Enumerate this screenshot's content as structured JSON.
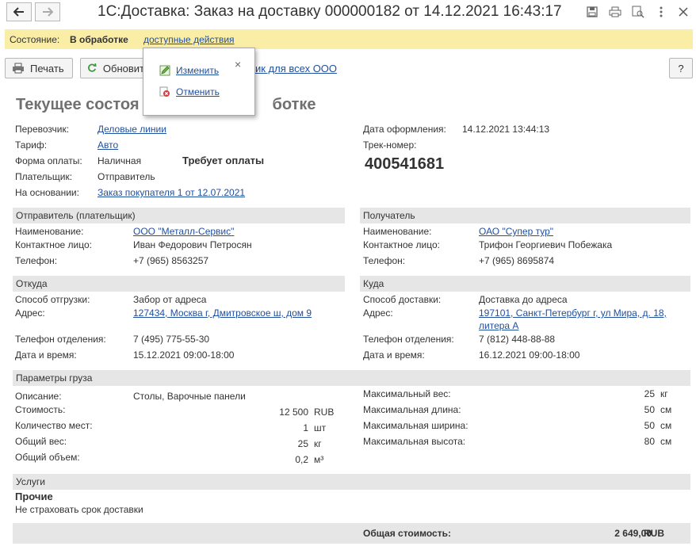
{
  "window": {
    "title": "1С:Доставка: Заказ на доставку 000000182 от 14.12.2021 16:43:17"
  },
  "statebar": {
    "label": "Состояние:",
    "value": "В обработке",
    "actions_link": "доступные действия"
  },
  "toolbar": {
    "print": "Печать",
    "refresh": "Обновит",
    "partial_link": "ик для всех ООО",
    "help": "?"
  },
  "popup": {
    "items": [
      {
        "label": "Изменить",
        "icon": "pencil-icon"
      },
      {
        "label": "Отменить",
        "icon": "cancel-icon"
      }
    ],
    "close": "×"
  },
  "heading": "Текущее состояние: в обработке",
  "heading_visible_left": "Текущее состоя",
  "heading_visible_right": "ботке",
  "general": {
    "carrier_label": "Перевозчик:",
    "carrier": "Деловые линии",
    "tariff_label": "Тариф:",
    "tariff": "Авто",
    "payment_label": "Форма оплаты:",
    "payment": "Наличная",
    "payment_status": "Требует оплаты",
    "payer_label": "Плательщик:",
    "payer": "Отправитель",
    "basis_label": "На основании:",
    "basis": "Заказ покупателя 1 от 12.07.2021",
    "date_label": "Дата оформления:",
    "date": "14.12.2021 13:44:13",
    "track_label": "Трек-номер:",
    "track": "400541681"
  },
  "sender": {
    "header": "Отправитель (плательщик)",
    "name_label": "Наименование:",
    "name": "ООО \"Металл-Сервис\"",
    "contact_label": "Контактное лицо:",
    "contact": "Иван Федорович Петросян",
    "phone_label": "Телефон:",
    "phone": "+7 (965) 8563257"
  },
  "receiver": {
    "header": "Получатель",
    "name_label": "Наименование:",
    "name": "ОАО \"Супер тур\"",
    "contact_label": "Контактное лицо:",
    "contact": "Трифон Георгиевич Побежака",
    "phone_label": "Телефон:",
    "phone": "+7 (965) 8695874"
  },
  "from": {
    "header": "Откуда",
    "method_label": "Способ отгрузки:",
    "method": "Забор от адреса",
    "address_label": "Адрес:",
    "address": "127434, Москва г, Дмитровское ш, дом 9",
    "branch_phone_label": "Телефон отделения:",
    "branch_phone": "7 (495) 775-55-30",
    "datetime_label": "Дата и время:",
    "datetime": "15.12.2021 09:00-18:00"
  },
  "to": {
    "header": "Куда",
    "method_label": "Способ доставки:",
    "method": "Доставка до адреса",
    "address_label": "Адрес:",
    "address_line1": "197101, Санкт-Петербург г, ул Мира, д. 18,",
    "address_line2": "литера А",
    "branch_phone_label": "Телефон отделения:",
    "branch_phone": "7 (812) 448-88-88",
    "datetime_label": "Дата и время:",
    "datetime": "16.12.2021 09:00-18:00"
  },
  "cargo": {
    "header": "Параметры груза",
    "desc_label": "Описание:",
    "desc": "Столы, Варочные панели",
    "cost_label": "Стоимость:",
    "cost": "12 500",
    "cost_unit": "RUB",
    "places_label": "Количество мест:",
    "places": "1",
    "places_unit": "шт",
    "weight_label": "Общий вес:",
    "weight": "25",
    "weight_unit": "кг",
    "volume_label": "Общий объем:",
    "volume": "0,2",
    "volume_unit": "м³",
    "max_weight_label": "Максимальный вес:",
    "max_weight": "25",
    "max_weight_unit": "кг",
    "max_length_label": "Максимальная длина:",
    "max_length": "50",
    "max_length_unit": "см",
    "max_width_label": "Максимальная ширина:",
    "max_width": "50",
    "max_width_unit": "см",
    "max_height_label": "Максимальная высота:",
    "max_height": "80",
    "max_height_unit": "см"
  },
  "services": {
    "header": "Услуги",
    "group": "Прочие",
    "item": "Не страховать срок доставки"
  },
  "total": {
    "label": "Общая стоимость:",
    "value": "2 649,00",
    "unit": "RUB"
  }
}
